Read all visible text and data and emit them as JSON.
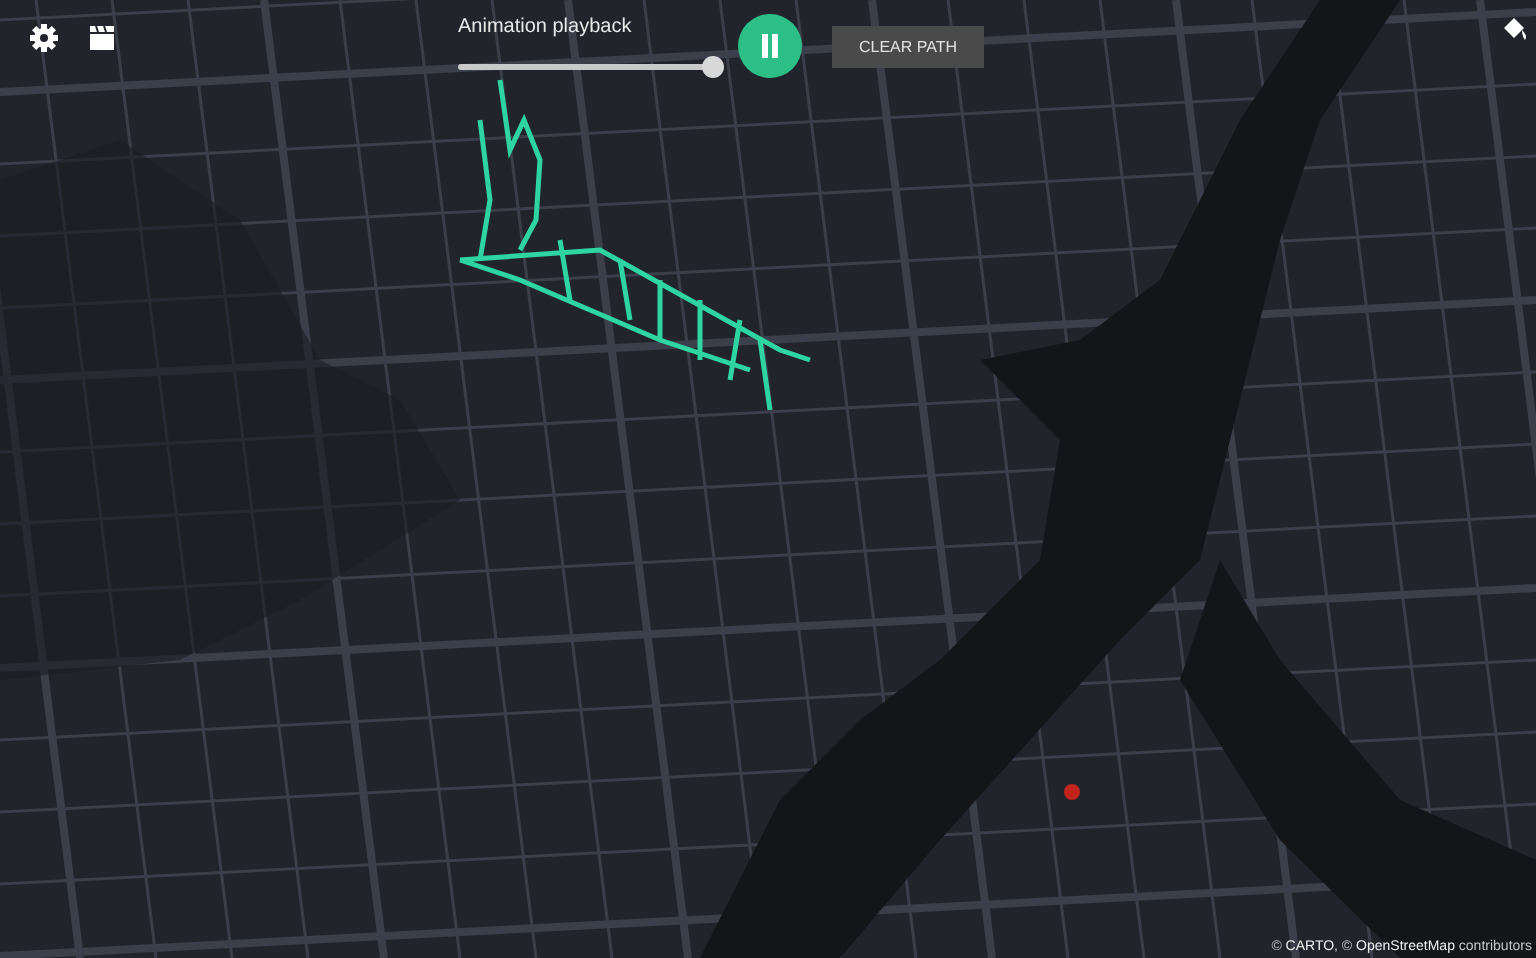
{
  "playback": {
    "label": "Animation playback",
    "level": 0.98,
    "playing": true
  },
  "clear_button": {
    "label": "CLEAR PATH"
  },
  "attribution": {
    "parts": [
      {
        "kind": "text",
        "text": "© "
      },
      {
        "kind": "link",
        "text": "CARTO"
      },
      {
        "kind": "text",
        "text": ", © "
      },
      {
        "kind": "link",
        "text": "OpenStreetMap"
      },
      {
        "kind": "text",
        "text": " contributors"
      }
    ]
  }
}
